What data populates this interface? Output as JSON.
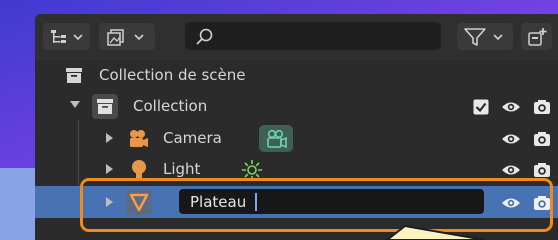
{
  "search": {
    "value": "",
    "placeholder": ""
  },
  "tree": {
    "scene": {
      "label": "Collection de scène"
    },
    "collection": {
      "label": "Collection",
      "checked": true
    },
    "camera": {
      "label": "Camera"
    },
    "light": {
      "label": "Light"
    },
    "plateau": {
      "edit_value": "Plateau"
    }
  },
  "colors": {
    "highlight": "#f08a18",
    "selection": "#4772b3",
    "camera_data": "#59b89b",
    "light_data": "#7ed35a",
    "object_icon": "#e8974a"
  },
  "icons": {
    "header": [
      "display-mode-icon",
      "filter-view-icon",
      "search-icon",
      "filter-funnel-icon",
      "new-collection-icon"
    ],
    "rows": [
      "collection-icon",
      "camera-object-icon",
      "camera-data-icon",
      "light-object-icon",
      "light-data-icon",
      "mesh-object-icon",
      "eye-icon",
      "camera-render-icon",
      "checkbox-icon"
    ]
  }
}
